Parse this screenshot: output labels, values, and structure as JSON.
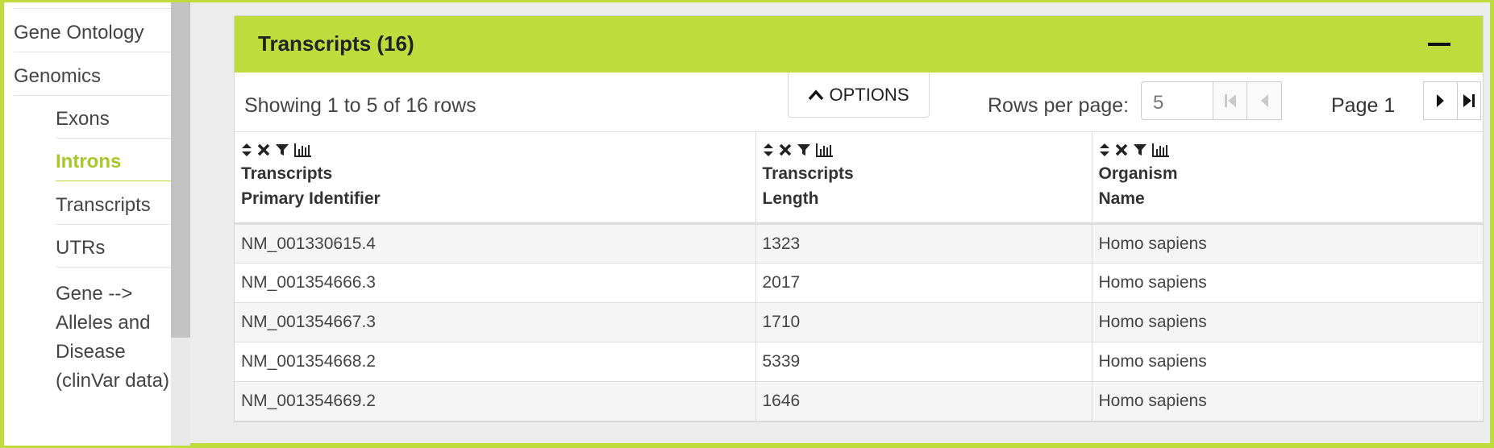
{
  "sidebar": {
    "items": [
      {
        "label": "Gene Ontology"
      },
      {
        "label": "Genomics"
      },
      {
        "label": "Exons"
      },
      {
        "label": "Introns"
      },
      {
        "label": "Transcripts"
      },
      {
        "label": "UTRs"
      },
      {
        "label": "Gene -->\nAlleles and\nDisease\n(clinVar data)"
      }
    ],
    "active_color": "#a8c72a"
  },
  "panel": {
    "title": "Transcripts (16)",
    "header_color": "#c0dc3c",
    "showing": "Showing 1 to 5 of 16 rows",
    "options_label": "OPTIONS",
    "rows_per_page_label": "Rows per page:",
    "rows_per_page_value": "5",
    "page_label": "Page 1"
  },
  "table": {
    "columns": [
      {
        "line1": "Transcripts",
        "line2": "Primary Identifier"
      },
      {
        "line1": "Transcripts",
        "line2": "Length"
      },
      {
        "line1": "Organism",
        "line2": "Name"
      }
    ],
    "rows": [
      [
        "NM_001330615.4",
        "1323",
        "Homo sapiens"
      ],
      [
        "NM_001354666.3",
        "2017",
        "Homo sapiens"
      ],
      [
        "NM_001354667.3",
        "1710",
        "Homo sapiens"
      ],
      [
        "NM_001354668.2",
        "5339",
        "Homo sapiens"
      ],
      [
        "NM_001354669.2",
        "1646",
        "Homo sapiens"
      ]
    ]
  }
}
